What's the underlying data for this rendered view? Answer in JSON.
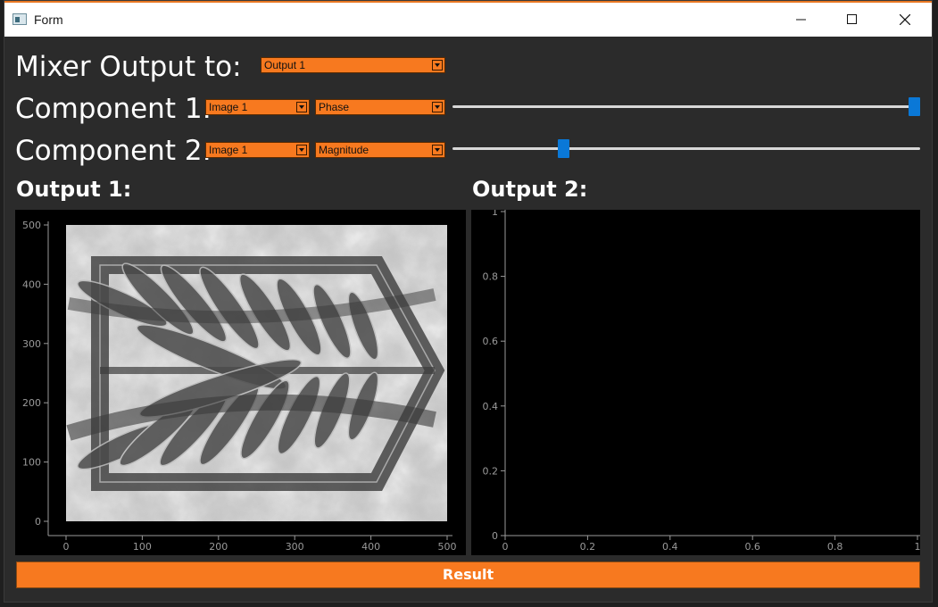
{
  "window": {
    "title": "Form",
    "controls": [
      "minimize-icon",
      "maximize-icon",
      "close-icon"
    ]
  },
  "mixer": {
    "label": "Mixer Output to:",
    "output_select": "Output 1"
  },
  "component1": {
    "label": "Component 1:",
    "image_select": "Image 1",
    "type_select": "Phase",
    "slider_value_fraction": 1.0
  },
  "component2": {
    "label": "Component 2:",
    "image_select": "Image 1",
    "type_select": "Magnitude",
    "slider_value_fraction": 0.23
  },
  "outputs": {
    "output1_label": "Output 1:",
    "output2_label": "Output 2:"
  },
  "result_button": "Result",
  "colors": {
    "accent": "#f7791f",
    "slider_handle": "#0a78d7",
    "background": "#2b2b2b"
  },
  "chart_data": [
    {
      "type": "heatmap",
      "name": "",
      "x_ticks": [
        "0",
        "100",
        "200",
        "300",
        "400",
        "500"
      ],
      "y_ticks": [
        "0",
        "100",
        "200",
        "300",
        "400",
        "500"
      ],
      "xlim": [
        0,
        500
      ],
      "ylim": [
        0,
        500
      ],
      "content": "grayscale image"
    },
    {
      "type": "line",
      "name": "",
      "x_ticks": [
        "0",
        "0.2",
        "0.4",
        "0.6",
        "0.8",
        "1"
      ],
      "y_ticks": [
        "0",
        "0.2",
        "0.4",
        "0.6",
        "0.8",
        "1"
      ],
      "xlim": [
        0,
        1
      ],
      "ylim": [
        0,
        1
      ],
      "series": []
    }
  ]
}
